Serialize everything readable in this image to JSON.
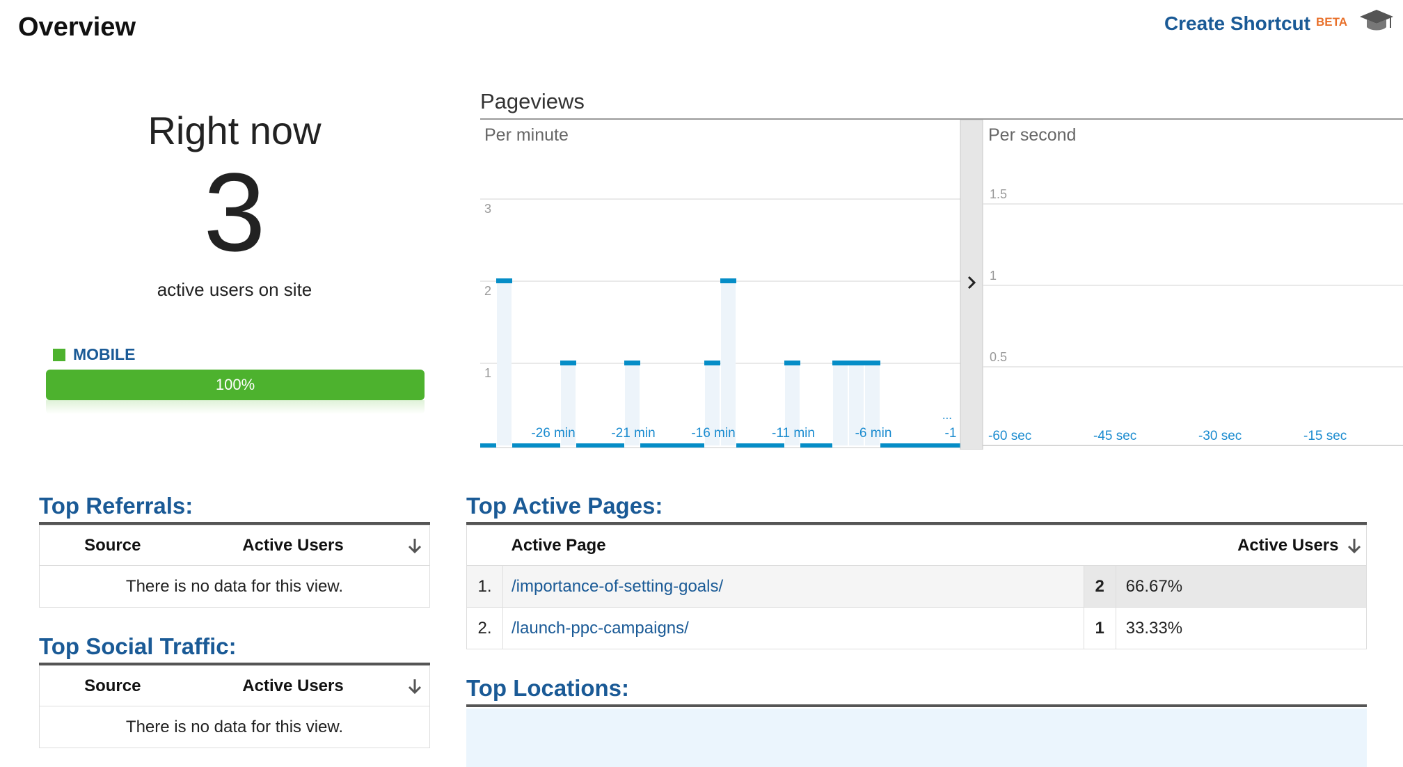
{
  "header": {
    "title": "Overview",
    "create_shortcut": "Create Shortcut",
    "beta": "BETA"
  },
  "right_now": {
    "title": "Right now",
    "count": "3",
    "subtitle": "active users on site",
    "device_legend": "MOBILE",
    "device_percent": "100%",
    "device_share": 1.0,
    "device_color": "#4db22e"
  },
  "pageviews": {
    "title": "Pageviews",
    "per_minute_label": "Per minute",
    "per_second_label": "Per second"
  },
  "chart_data": [
    {
      "type": "bar",
      "title": "Per minute",
      "ylim": [
        0,
        3
      ],
      "yticks": [
        "3",
        "2",
        "1"
      ],
      "x_tick_labels": [
        "-26 min",
        "-21 min",
        "-16 min",
        "-11 min",
        "-6 min",
        "-1"
      ],
      "x_tick_ellipsis": "...",
      "values": [
        0,
        2,
        0,
        0,
        0,
        1,
        0,
        0,
        0,
        1,
        0,
        0,
        0,
        0,
        1,
        2,
        0,
        0,
        0,
        1,
        0,
        0,
        1,
        1,
        1,
        0,
        0,
        0,
        0,
        0
      ],
      "grid": true,
      "bar_color": "#058dc7"
    },
    {
      "type": "bar",
      "title": "Per second",
      "ylim": [
        0,
        2
      ],
      "yticks": [
        "1.5",
        "1",
        "0.5"
      ],
      "x_tick_labels": [
        "-60 sec",
        "-45 sec",
        "-30 sec",
        "-15 sec"
      ],
      "values": [],
      "grid": true
    }
  ],
  "top_referrals": {
    "title": "Top Referrals:",
    "col_source": "Source",
    "col_users": "Active Users",
    "empty": "There is no data for this view."
  },
  "top_social": {
    "title": "Top Social Traffic:",
    "col_source": "Source",
    "col_users": "Active Users",
    "empty": "There is no data for this view."
  },
  "top_pages": {
    "title": "Top Active Pages:",
    "col_page": "Active Page",
    "col_users": "Active Users",
    "rows": [
      {
        "rank": "1.",
        "page": "/importance-of-setting-goals/",
        "users": "2",
        "percent": "66.67%"
      },
      {
        "rank": "2.",
        "page": "/launch-ppc-campaigns/",
        "users": "1",
        "percent": "33.33%"
      }
    ]
  },
  "top_locations": {
    "title": "Top Locations:"
  }
}
